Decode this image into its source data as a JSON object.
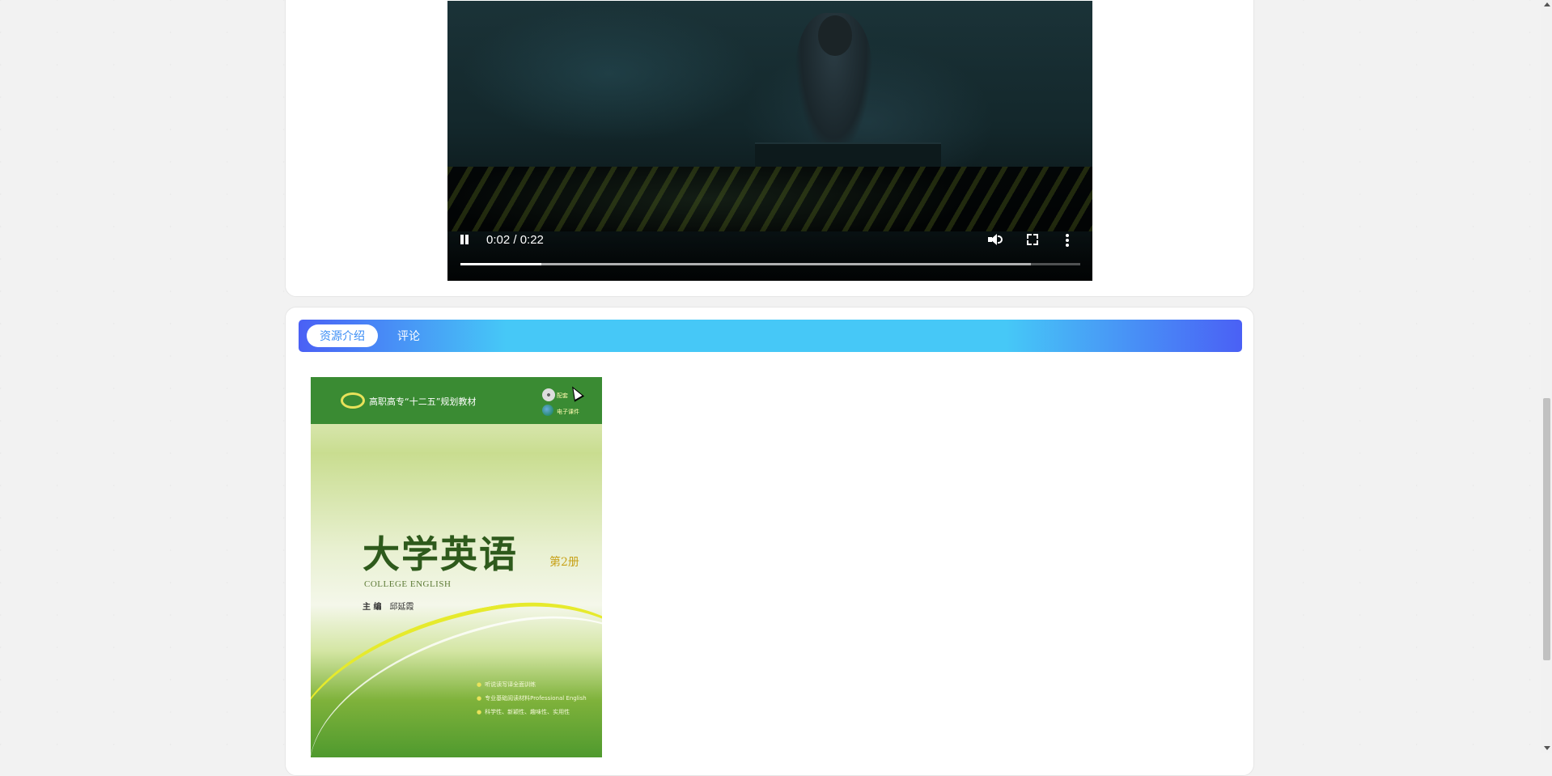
{
  "video": {
    "current_time": "0:02",
    "duration": "0:22",
    "time_display": "0:02 / 0:22",
    "progress_played": 0.13,
    "progress_buffered": 0.92,
    "icons": [
      "pause-icon",
      "volume-icon",
      "fullscreen-icon",
      "more-vert-icon"
    ]
  },
  "tabs": [
    {
      "label": "资源介绍",
      "active": true
    },
    {
      "label": "评论",
      "active": false
    }
  ],
  "cover": {
    "series": "高职高专“十二五”规划教材",
    "badge_1": "配套",
    "badge_2": "电子课件",
    "title": "大学英语",
    "volume": "第2册",
    "english_title": "COLLEGE ENGLISH",
    "editor_label": "主 编",
    "editor_name": "邱延霞",
    "bullets": [
      "听说读写译全面训练",
      "专业基础阅读材料Professional English",
      "科学性、新颖性、趣味性、实用性"
    ]
  },
  "colors": {
    "tab_gradient_edge": "#4a60f5",
    "tab_gradient_mid": "#46c8f7",
    "tab_active_text": "#3c8ef5",
    "cover_header": "#3a8b33"
  }
}
